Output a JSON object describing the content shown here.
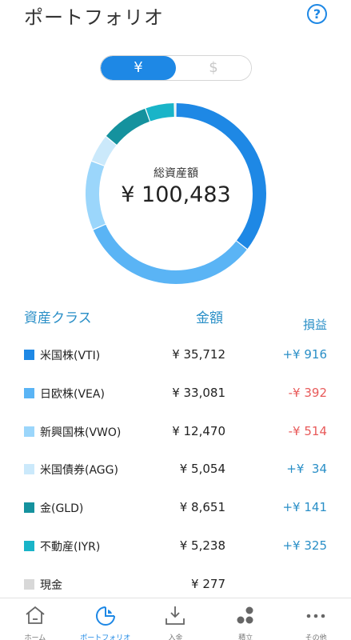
{
  "header": {
    "title": "ポートフォリオ",
    "help_icon": "help-icon"
  },
  "currency_toggle": {
    "options": [
      "¥",
      "$"
    ],
    "selected": "¥"
  },
  "summary": {
    "label": "総資産額",
    "total": "¥ 100,483"
  },
  "table": {
    "headers": {
      "asset_class": "資産クラス",
      "amount": "金額",
      "profit_loss": "損益"
    },
    "rows": [
      {
        "name": "米国株(VTI)",
        "amount": "¥ 35,712",
        "pl": "+¥ 916",
        "color": "#1e88e5",
        "pl_color": "#2a8fc7",
        "value": 35712
      },
      {
        "name": "日欧株(VEA)",
        "amount": "¥ 33,081",
        "pl": "-¥ 392",
        "color": "#5ab4f5",
        "pl_color": "#e85a5a",
        "value": 33081
      },
      {
        "name": "新興国株(VWO)",
        "amount": "¥ 12,470",
        "pl": "-¥ 514",
        "color": "#9bd6fb",
        "pl_color": "#e85a5a",
        "value": 12470
      },
      {
        "name": "米国債券(AGG)",
        "amount": "¥ 5,054",
        "pl": "+¥  34",
        "color": "#cbe9fb",
        "pl_color": "#2a8fc7",
        "value": 5054
      },
      {
        "name": "金(GLD)",
        "amount": "¥ 8,651",
        "pl": "+¥ 141",
        "color": "#15929e",
        "pl_color": "#2a8fc7",
        "value": 8651
      },
      {
        "name": "不動産(IYR)",
        "amount": "¥ 5,238",
        "pl": "+¥ 325",
        "color": "#19b4c8",
        "pl_color": "#2a8fc7",
        "value": 5238
      },
      {
        "name": "現金",
        "amount": "¥ 277",
        "pl": "",
        "color": "#d8d8d8",
        "pl_color": "#2a8fc7",
        "value": 277
      }
    ]
  },
  "tabbar": {
    "items": [
      {
        "label": "ホーム",
        "icon": "home-icon",
        "active": false
      },
      {
        "label": "ポートフォリオ",
        "icon": "portfolio-icon",
        "active": true
      },
      {
        "label": "入金",
        "icon": "deposit-icon",
        "active": false
      },
      {
        "label": "積立",
        "icon": "savings-icon",
        "active": false
      },
      {
        "label": "その他",
        "icon": "more-icon",
        "active": false
      }
    ]
  },
  "colors": {
    "accent": "#1e88e5",
    "header_text": "#2a8fc7",
    "loss": "#e85a5a"
  }
}
